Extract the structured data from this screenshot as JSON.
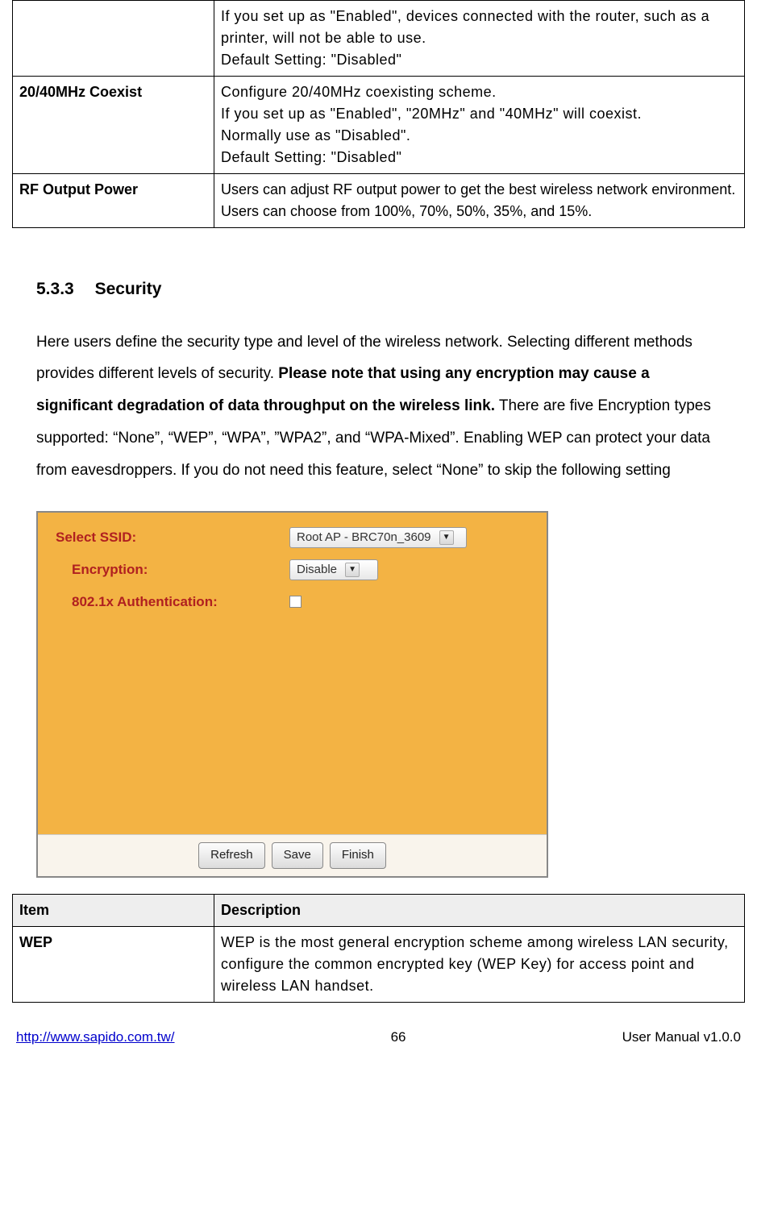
{
  "table1": {
    "row0": "If you set up as \"Enabled\", devices connected with the router, such as a printer, will not be able to use.\nDefault Setting: \"Disabled\"",
    "row1_label": "20/40MHz Coexist",
    "row1_desc": "Configure 20/40MHz coexisting scheme.\nIf you set up as \"Enabled\", \"20MHz\" and \"40MHz\" will coexist.\nNormally use as \"Disabled\".\nDefault Setting: \"Disabled\"",
    "row2_label": "RF Output Power",
    "row2_desc": "Users can adjust RF output power to get the best wireless network environment. Users can choose from 100%, 70%, 50%, 35%, and 15%."
  },
  "section": {
    "num": "5.3.3",
    "title": "Security",
    "para_a": "Here users define the security type and level of the wireless network. Selecting different methods provides different levels of security.   ",
    "para_bold": "Please note that using any encryption may cause a significant degradation of data throughput on the wireless link.",
    "para_b": " There are five Encryption types supported: “None”, “WEP”, “WPA”, ”WPA2”, and “WPA-Mixed”. Enabling WEP can protect your data from eavesdroppers. If you do not need this feature, select “None” to skip the following setting"
  },
  "screenshot": {
    "ssid_label": "Select SSID:",
    "ssid_value": "Root AP - BRC70n_3609",
    "enc_label": "Encryption:",
    "enc_value": "Disable",
    "auth_label": "802.1x Authentication:",
    "btn_refresh": "Refresh",
    "btn_save": "Save",
    "btn_finish": "Finish"
  },
  "table2": {
    "h_item": "Item",
    "h_desc": "Description",
    "r1_label": "WEP",
    "r1_desc": "WEP is the most general encryption scheme among wireless LAN security, configure the common encrypted key (WEP Key) for access point and wireless LAN handset."
  },
  "footer": {
    "url": "http://www.sapido.com.tw/",
    "page": "66",
    "right": "User Manual v1.0.0"
  }
}
